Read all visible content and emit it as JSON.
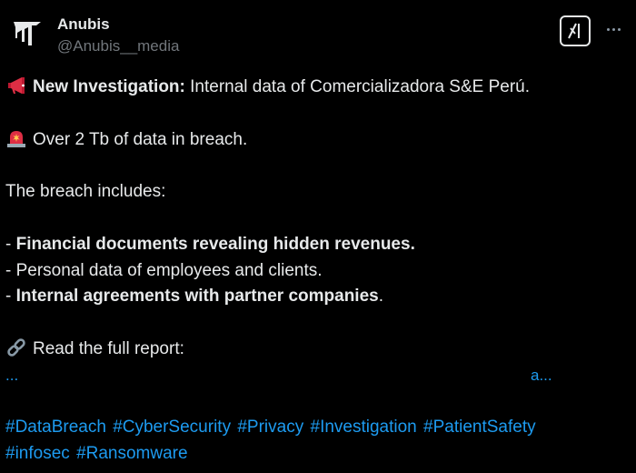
{
  "author": {
    "name": "Anubis",
    "handle": "@Anubis__media"
  },
  "icons": {
    "avatar": "anubis-logo-icon",
    "grok": "grok-icon",
    "more": "more-options-icon",
    "megaphone": "megaphone-icon",
    "siren": "siren-icon",
    "link": "link-icon"
  },
  "post": {
    "headline_bold": "New Investigation:",
    "headline_rest": " Internal data of Comercializadora S&E Perú.",
    "volume": "Over 2 Tb of data in breach.",
    "includes_intro": "The breach includes:",
    "items": [
      {
        "prefix": "- ",
        "bold": "Financial documents revealing hidden revenues.",
        "rest": ""
      },
      {
        "prefix": "- ",
        "bold": "",
        "rest": "Personal data of employees and clients."
      },
      {
        "prefix": "- ",
        "bold": "Internal agreements with partner companies",
        "rest": "."
      }
    ],
    "report_label": "Read the full report:",
    "link_left": "...",
    "link_right": "a...",
    "hashtags_line1": [
      "#DataBreach",
      "#CyberSecurity",
      "#Privacy",
      "#Investigation",
      "#PatientSafety"
    ],
    "hashtags_line2": [
      "#infosec",
      "#Ransomware"
    ]
  },
  "colors": {
    "background": "#000000",
    "text": "#e7e9ea",
    "muted": "#71767b",
    "link": "#1d9bf0"
  }
}
